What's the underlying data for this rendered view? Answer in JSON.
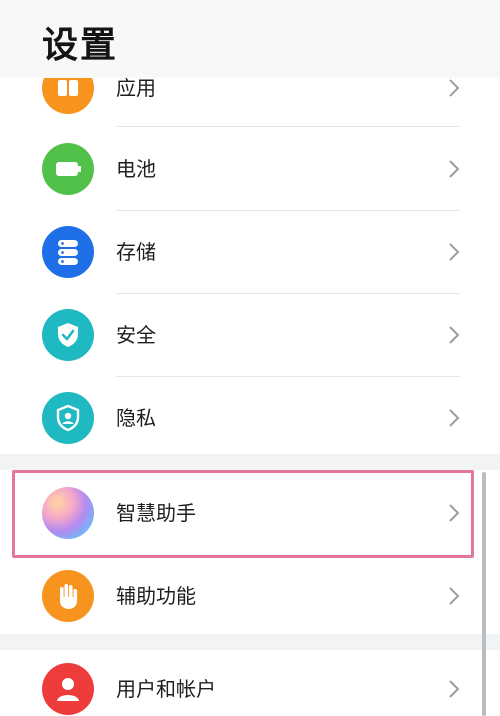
{
  "header": {
    "title": "设置"
  },
  "items": [
    {
      "label": "应用",
      "icon": "apps-icon",
      "color": "#f7941d"
    },
    {
      "label": "电池",
      "icon": "battery-icon",
      "color": "#52c14a"
    },
    {
      "label": "存储",
      "icon": "storage-icon",
      "color": "#1e6fe8"
    },
    {
      "label": "安全",
      "icon": "shield-check-icon",
      "color": "#1fb9c2"
    },
    {
      "label": "隐私",
      "icon": "privacy-shield-icon",
      "color": "#1fb9c2"
    },
    {
      "label": "智慧助手",
      "icon": "smart-assistant-icon",
      "color": "#a97be8"
    },
    {
      "label": "辅助功能",
      "icon": "hand-icon",
      "color": "#f7941d"
    },
    {
      "label": "用户和帐户",
      "icon": "user-icon",
      "color": "#ee3b3b"
    }
  ],
  "highlight_color": "#e2779a"
}
